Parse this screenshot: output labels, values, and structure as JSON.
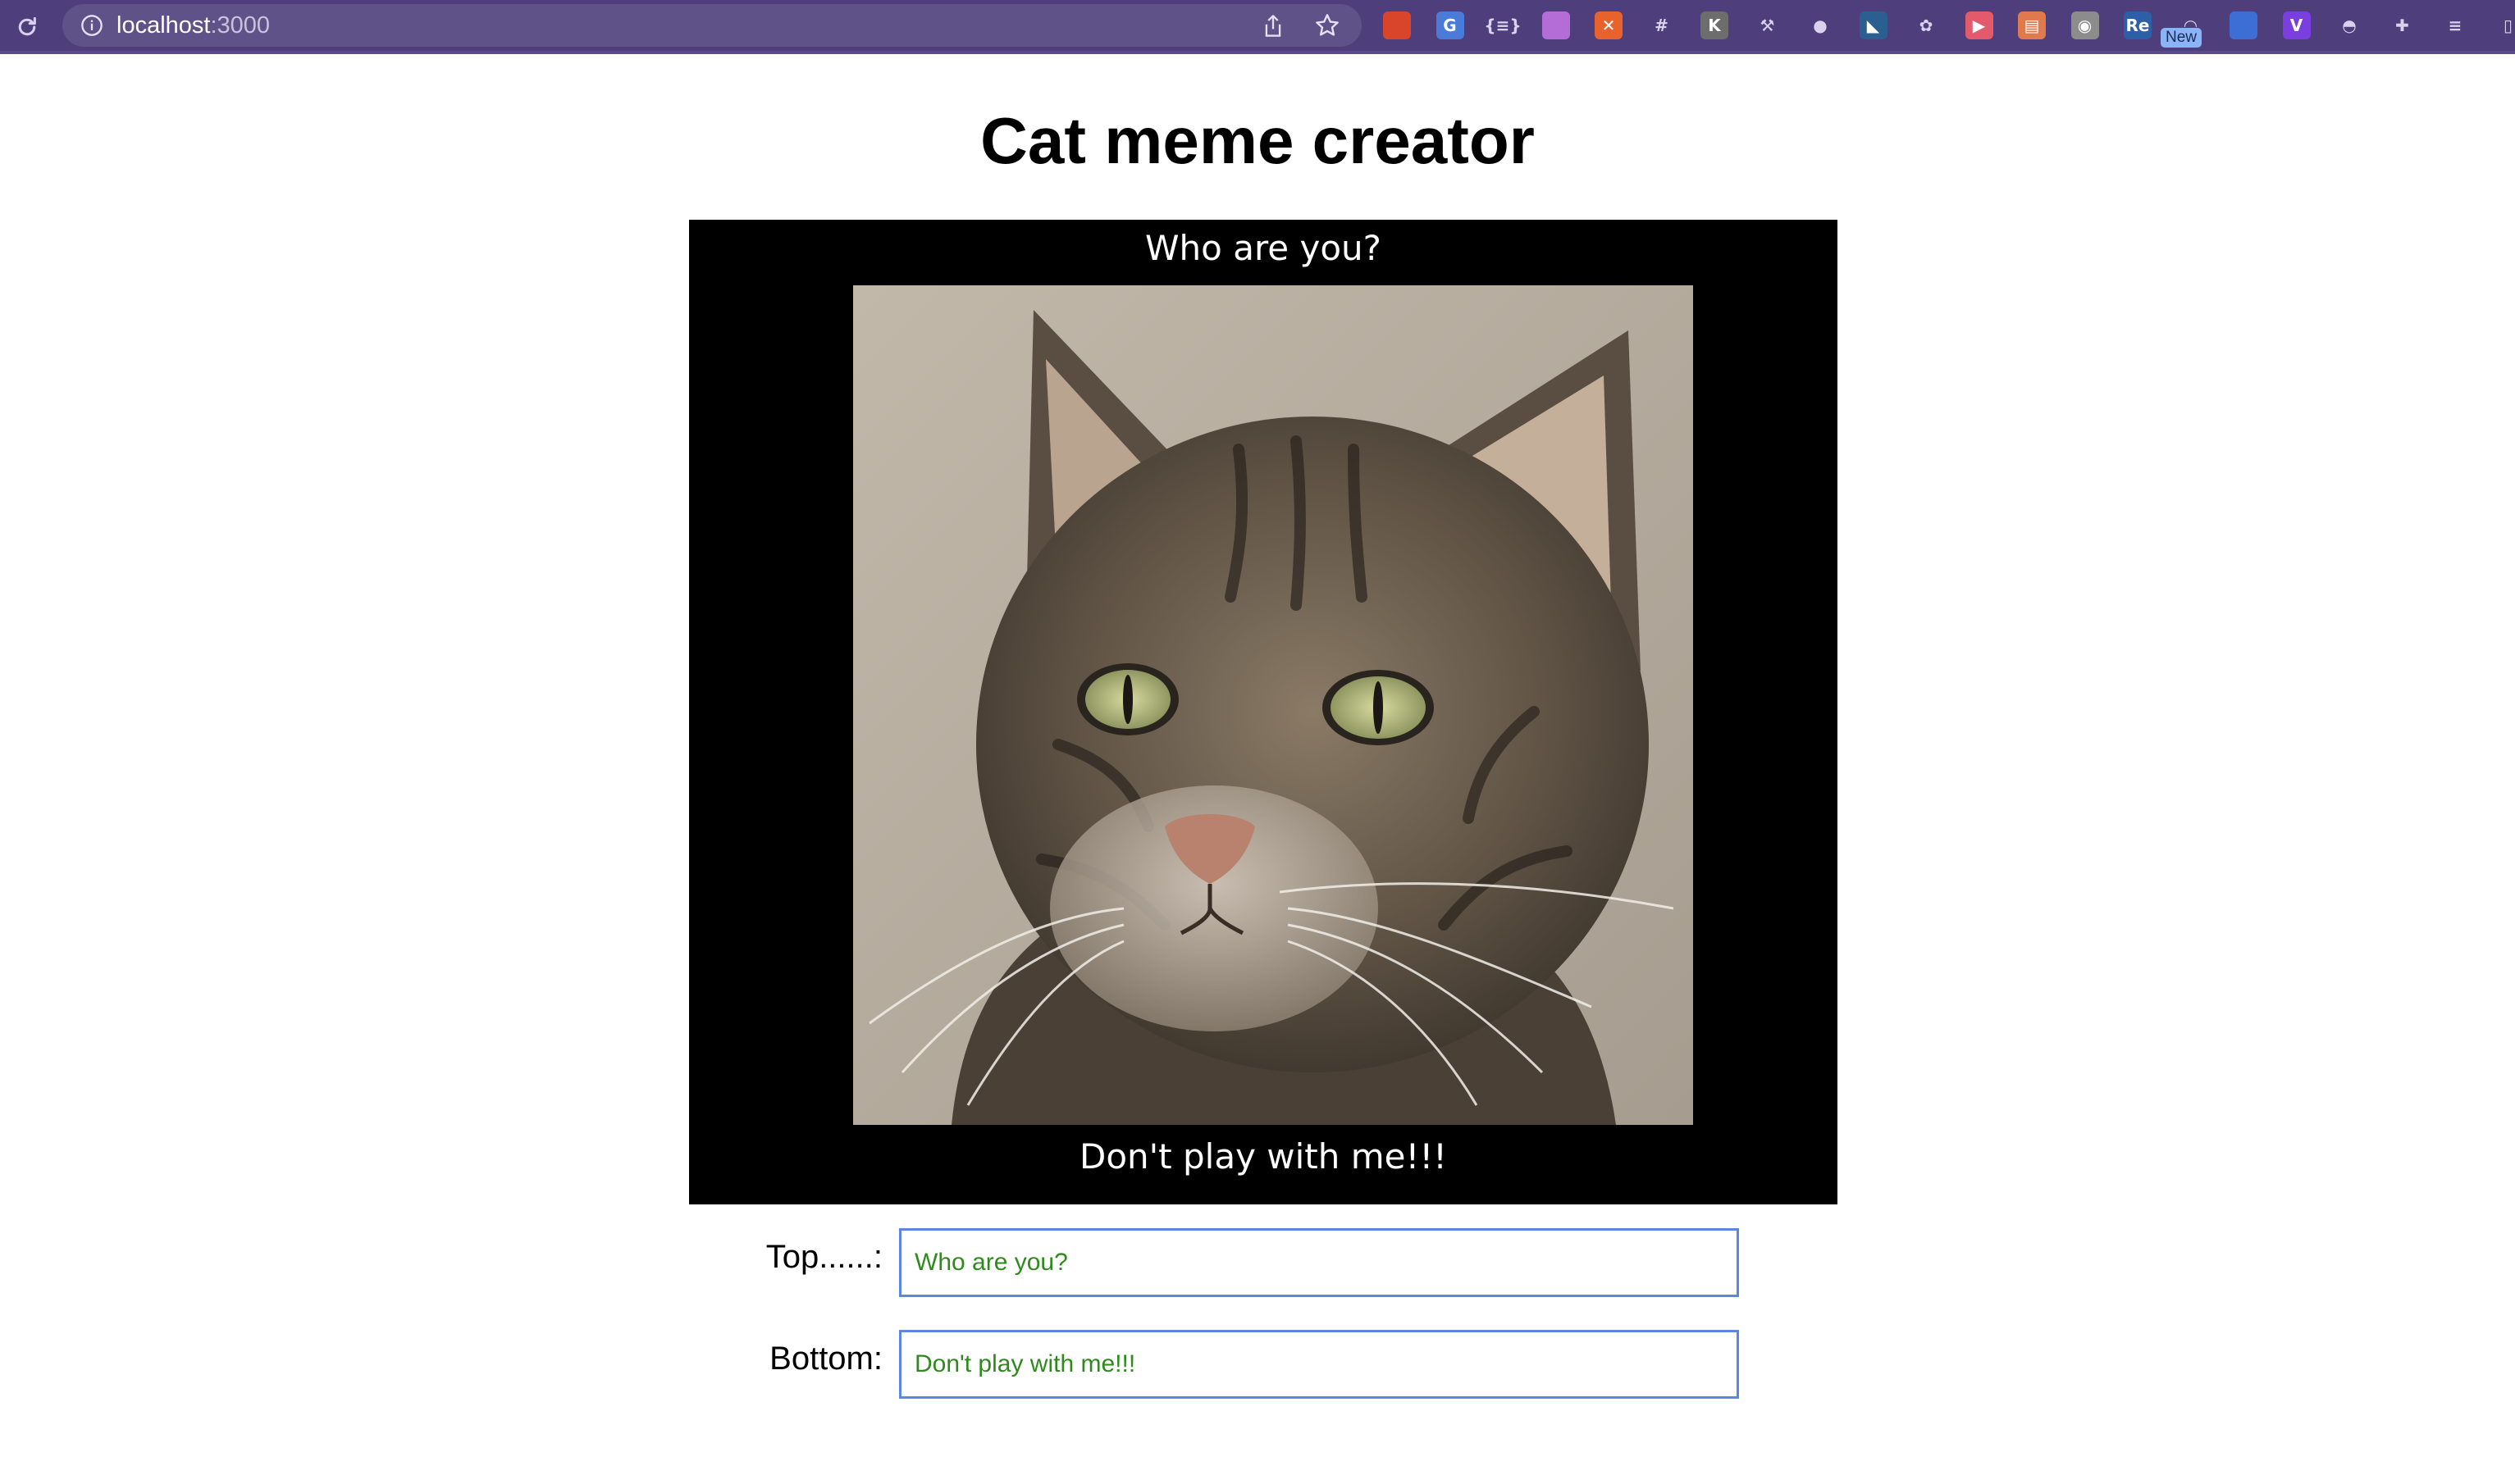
{
  "browser": {
    "url_host": "localhost",
    "url_port": ":3000",
    "new_badge": "New",
    "extensions": [
      {
        "name": "ext-red-book-icon",
        "glyph": "",
        "color": "#d9452b"
      },
      {
        "name": "ext-translate-icon",
        "glyph": "G",
        "color": "#4a7bd8"
      },
      {
        "name": "ext-json-braces-icon",
        "glyph": "{≡}",
        "color": "transparent"
      },
      {
        "name": "ext-color-wheel-icon",
        "glyph": "",
        "color": "#b46cd6"
      },
      {
        "name": "ext-orange-circle-icon",
        "glyph": "✕",
        "color": "#e8622c"
      },
      {
        "name": "ext-hashtag-icon",
        "glyph": "#",
        "color": "transparent"
      },
      {
        "name": "ext-k-icon",
        "glyph": "K",
        "color": "#6d6d6d"
      },
      {
        "name": "ext-tool-icon",
        "glyph": "⚒",
        "color": "transparent"
      },
      {
        "name": "ext-people-icon",
        "glyph": "●",
        "color": "transparent"
      },
      {
        "name": "ext-arrow-icon",
        "glyph": "◣",
        "color": "#2a5f8f"
      },
      {
        "name": "ext-bug-icon",
        "glyph": "✿",
        "color": "transparent"
      },
      {
        "name": "ext-record-icon",
        "glyph": "▶",
        "color": "#e25a6b"
      },
      {
        "name": "ext-chart-icon",
        "glyph": "▤",
        "color": "#e07a4e"
      },
      {
        "name": "ext-grey-icon",
        "glyph": "◉",
        "color": "#8c8c8c"
      },
      {
        "name": "ext-re-icon",
        "glyph": "Re",
        "color": "#2d5fa8"
      },
      {
        "name": "ext-rainbow-icon",
        "glyph": "◠",
        "color": "transparent"
      },
      {
        "name": "ext-blue-rect-icon",
        "glyph": "",
        "color": "#3d6ed6"
      },
      {
        "name": "ext-v-icon",
        "glyph": "V",
        "color": "#7b3fe0"
      },
      {
        "name": "ext-pokeball-icon",
        "glyph": "◓",
        "color": "transparent"
      },
      {
        "name": "extensions-puzzle-icon",
        "glyph": "✚",
        "color": "transparent"
      },
      {
        "name": "reading-list-icon",
        "glyph": "≡",
        "color": "transparent"
      },
      {
        "name": "side-panel-icon",
        "glyph": "▯",
        "color": "transparent"
      }
    ]
  },
  "page": {
    "title": "Cat meme creator"
  },
  "meme": {
    "top_text": "Who are you?",
    "bottom_text": "Don't play with me!!!"
  },
  "form": {
    "top_label": "Top......:",
    "top_value": "Who are you?",
    "bottom_label": "Bottom:",
    "bottom_value": "Don't play with me!!!"
  },
  "colors": {
    "toolbar": "#4e3f7c",
    "input_border": "#5b87e0",
    "input_text": "#2f8a1e"
  }
}
